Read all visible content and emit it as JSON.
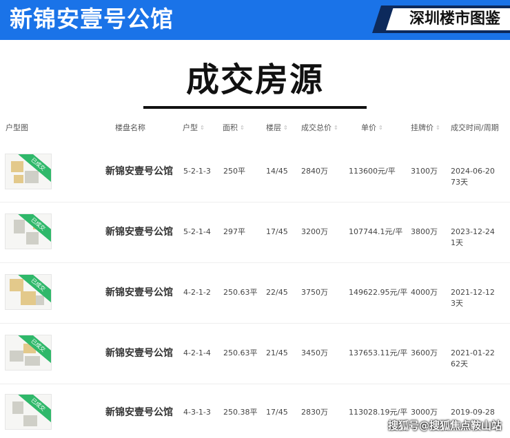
{
  "header": {
    "title": "新锦安壹号公馆",
    "tag": "深圳楼市图鉴"
  },
  "section_title": "成交房源",
  "table": {
    "columns": {
      "floorplan": "户型图",
      "project": "楼盘名称",
      "unit_type": "户型",
      "area": "面积",
      "floor": "楼层",
      "total_price": "成交总价",
      "unit_price": "单价",
      "list_price": "挂牌价",
      "deal_time": "成交时间/周期"
    },
    "sold_badge": "已成交",
    "rows": [
      {
        "project": "新锦安壹号公馆",
        "unit_type": "5-2-1-3",
        "area": "250平",
        "floor": "14/45",
        "total_price": "2840万",
        "unit_price": "113600元/平",
        "list_price": "3100万",
        "date": "2024-06-20",
        "cycle": "73天"
      },
      {
        "project": "新锦安壹号公馆",
        "unit_type": "5-2-1-4",
        "area": "297平",
        "floor": "17/45",
        "total_price": "3200万",
        "unit_price": "107744.1元/平",
        "list_price": "3800万",
        "date": "2023-12-24",
        "cycle": "1天"
      },
      {
        "project": "新锦安壹号公馆",
        "unit_type": "4-2-1-2",
        "area": "250.63平",
        "floor": "22/45",
        "total_price": "3750万",
        "unit_price": "149622.95元/平",
        "list_price": "4000万",
        "date": "2021-12-12",
        "cycle": "3天"
      },
      {
        "project": "新锦安壹号公馆",
        "unit_type": "4-2-1-4",
        "area": "250.63平",
        "floor": "21/45",
        "total_price": "3450万",
        "unit_price": "137653.11元/平",
        "list_price": "3600万",
        "date": "2021-01-22",
        "cycle": "62天"
      },
      {
        "project": "新锦安壹号公馆",
        "unit_type": "4-3-1-3",
        "area": "250.38平",
        "floor": "17/45",
        "total_price": "2830万",
        "unit_price": "113028.19元/平",
        "list_price": "3000万",
        "date": "2019-09-28",
        "cycle": ""
      }
    ]
  },
  "watermark": "搜狐号@搜狐焦点鞍山站",
  "colors": {
    "banner": "#1a73e8",
    "tag_bg": "#0d2a5c",
    "badge": "#2fb86a"
  }
}
